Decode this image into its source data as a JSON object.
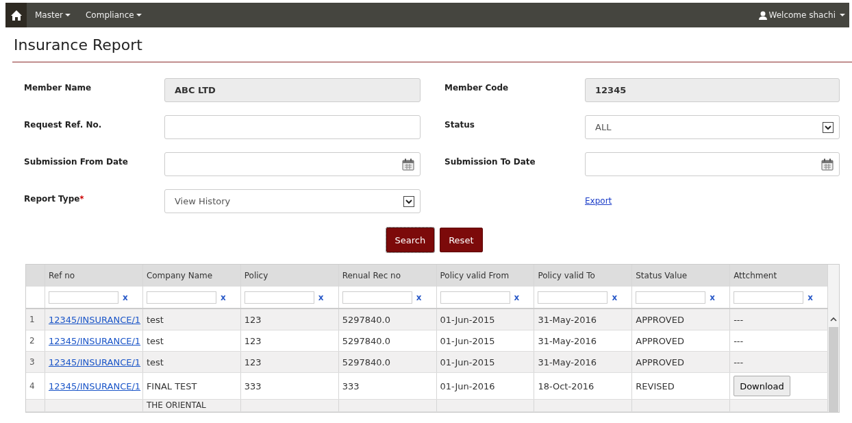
{
  "navbar": {
    "menus": [
      {
        "label": "Master"
      },
      {
        "label": "Compliance"
      }
    ],
    "user": "Welcome shachi"
  },
  "page_title": "Insurance Report",
  "form": {
    "left": [
      {
        "label": "Member Name",
        "kind": "readonly",
        "value": "ABC LTD"
      },
      {
        "label": "Request Ref. No.",
        "kind": "text"
      },
      {
        "label": "Submission From Date",
        "kind": "date"
      },
      {
        "label": "Report Type",
        "required_mark": "*",
        "kind": "select",
        "value": "View History"
      }
    ],
    "right": [
      {
        "label": "Member Code",
        "kind": "readonly",
        "value": "12345"
      },
      {
        "label": "Status",
        "kind": "select",
        "value": "ALL"
      },
      {
        "label": "Submission To Date",
        "kind": "date"
      },
      {
        "kind": "link",
        "label": "Export"
      }
    ],
    "buttons": [
      "Search",
      "Reset"
    ]
  },
  "table": {
    "columns": [
      {
        "label": "Ref no",
        "filter_clear": "x"
      },
      {
        "label": "Company Name",
        "filter_clear": "x"
      },
      {
        "label": "Policy",
        "filter_clear": "x"
      },
      {
        "label": "Renual Rec no",
        "filter_clear": "x"
      },
      {
        "label": "Policy valid From",
        "filter_clear": "x"
      },
      {
        "label": "Policy valid To",
        "filter_clear": "x"
      },
      {
        "label": "Status Value",
        "filter_clear": "x"
      },
      {
        "label": "Attchment",
        "filter_clear": "x"
      }
    ],
    "rows": [
      {
        "index": "1",
        "cells": [
          "12345/INSURANCE/1",
          "test",
          "123",
          "5297840.0",
          "01-Jun-2015",
          "31-May-2016",
          "APPROVED",
          "---"
        ]
      },
      {
        "index": "2",
        "cells": [
          "12345/INSURANCE/1",
          "test",
          "123",
          "5297840.0",
          "01-Jun-2015",
          "31-May-2016",
          "APPROVED",
          "---"
        ]
      },
      {
        "index": "3",
        "cells": [
          "12345/INSURANCE/1",
          "test",
          "123",
          "5297840.0",
          "01-Jun-2015",
          "31-May-2016",
          "APPROVED",
          "---"
        ]
      },
      {
        "index": "4",
        "cells": [
          "12345/INSURANCE/1",
          "FINAL TEST",
          "333",
          "333",
          "01-Jun-2016",
          "18-Oct-2016",
          "REVISED",
          "Download"
        ]
      },
      {
        "index": "",
        "cells": [
          "",
          "THE ORIENTAL",
          "",
          "",
          "",
          "",
          "",
          ""
        ]
      }
    ]
  }
}
